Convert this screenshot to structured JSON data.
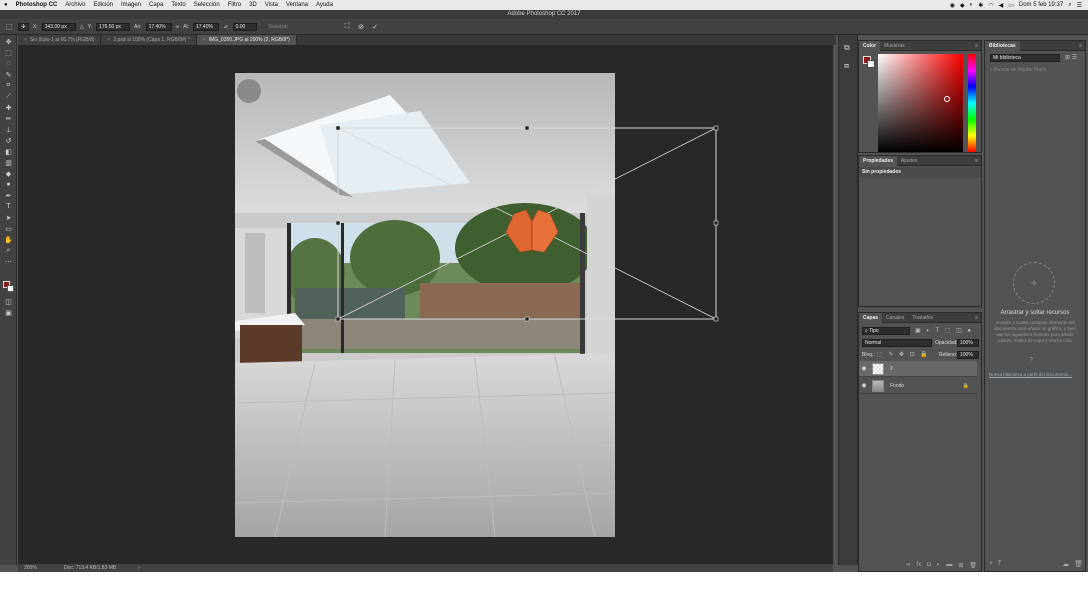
{
  "menubar": {
    "apple": "",
    "items": [
      "Photoshop CC",
      "Archivo",
      "Edición",
      "Imagen",
      "Capa",
      "Texto",
      "Selección",
      "Filtro",
      "3D",
      "Vista",
      "Ventana",
      "Ayuda"
    ],
    "datetime": "Dom 5 feb  19:37"
  },
  "window": {
    "title": "Adobe Photoshop CC 2017"
  },
  "options": {
    "x_label": "X:",
    "x_value": "343.00 px",
    "y_label": "Y:",
    "y_value": "176.50 px",
    "w_label": "An:",
    "w_value": "17.40%",
    "h_label": "Al:",
    "h_value": "17.40%",
    "angle_label": "⊿:",
    "angle_value": "0.00",
    "interp_label": "Suavizar"
  },
  "tabs": [
    {
      "label": "Sin título-1 al 66.7% (RGB/8)",
      "active": false
    },
    {
      "label": "2.psd al 100% (Capa 1, RGB/8#) *",
      "active": false
    },
    {
      "label": "IMG_0350.JPG al 200% (2, RGB/8*)",
      "active": true
    }
  ],
  "status": {
    "zoom": "200%",
    "doc": "Doc: 713.4 KB/1.83 MB"
  },
  "color_panel": {
    "tabs": [
      "Color",
      "Muestras"
    ],
    "fg": "#8a1a1a",
    "bg": "#ffffff",
    "hue": "#ff0000"
  },
  "props_panel": {
    "tabs": [
      "Propiedades",
      "Ajustes"
    ],
    "body": "Sin propiedades"
  },
  "layers_panel": {
    "tabs": [
      "Capas",
      "Canales",
      "Trazados"
    ],
    "kind": "Tipo",
    "blend": "Normal",
    "opacity_label": "Opacidad:",
    "opacity": "100%",
    "lock_label": "Bloq.:",
    "fill_label": "Relleno:",
    "fill": "100%",
    "layers": [
      {
        "name": "2",
        "selected": true
      },
      {
        "name": "Fondo",
        "selected": false
      }
    ]
  },
  "libraries_panel": {
    "tab": "Bibliotecas",
    "library": "Mi biblioteca",
    "search_placeholder": "Buscar en Adobe Stock",
    "drop_title": "Arrastrar y soltar recursos",
    "drop_desc": "Arrastre y suelte cualquier elemento del documento para añadir un gráfico, o bien use los siguientes botones para añadir colores, estilos de capa y mucho más.",
    "link": "Nueva biblioteca a partir del documento..."
  }
}
